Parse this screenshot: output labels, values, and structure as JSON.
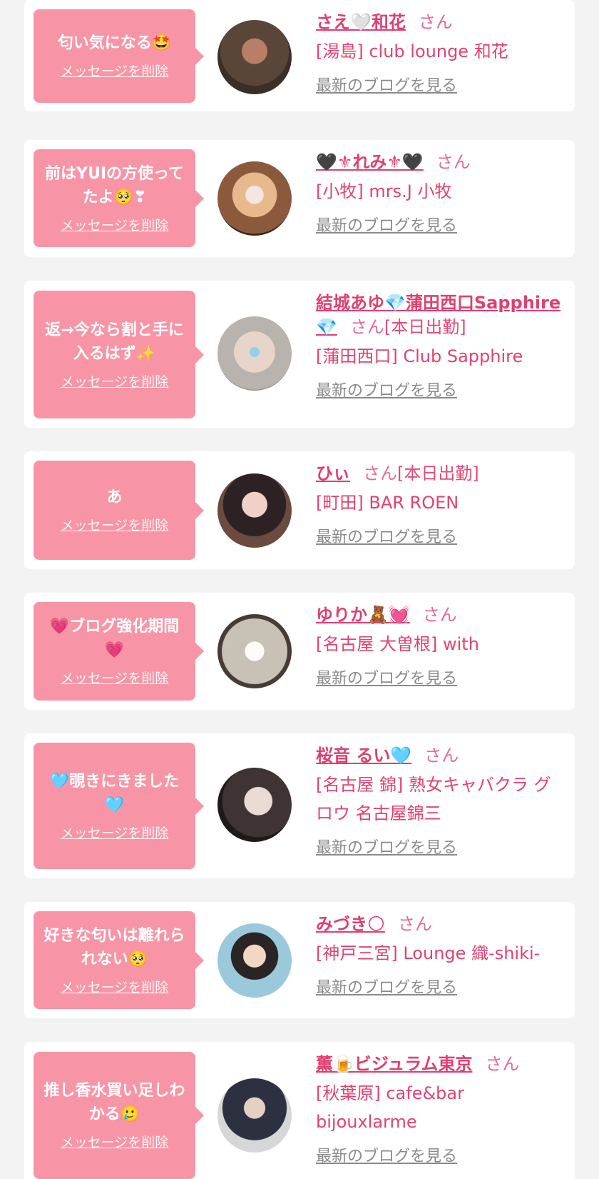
{
  "delete_label": "メッセージを削除",
  "blog_label": "最新のブログを見る",
  "san_label": "さん",
  "colors": {
    "bubble": "#f795a6",
    "name": "#e03f70",
    "shop": "#e4416f",
    "blog": "#8a8a8a",
    "background": "#f4f3f3"
  },
  "messages": [
    {
      "message": "匂い気になる🤩",
      "name": "さえ🤍和花",
      "status": "",
      "shop": "[湯島] club lounge 和花",
      "avatar_colors": [
        "#5a4638",
        "#b87f66",
        "#3b2e28"
      ]
    },
    {
      "message": "前はYUIの方使ってたよ🥺❣",
      "name": "🖤⚜れみ⚜🖤",
      "status": "",
      "shop": "[小牧] mrs.J 小牧",
      "avatar_colors": [
        "#8b5a3c",
        "#e9b98e",
        "#3a2418"
      ]
    },
    {
      "message": "返→今なら割と手に入るはず✨",
      "name": "結城あゆ💎蒲田西口Sapphire💎",
      "status": "[本日出勤]",
      "shop": "[蒲田西口] Club Sapphire",
      "avatar_colors": [
        "#b9b3ad",
        "#e8d5c9",
        "#8d847e"
      ]
    },
    {
      "message": "あ",
      "name": "ひぃ",
      "status": "[本日出勤]",
      "shop": "[町田] BAR ROEN",
      "avatar_colors": [
        "#2c2224",
        "#f0d1c7",
        "#6b4a3f"
      ]
    },
    {
      "message": "💗ブログ強化期間💗",
      "name": "ゆりか🧸💓",
      "status": "",
      "shop": "[名古屋 大曽根] with",
      "avatar_colors": [
        "#c8c1b6",
        "#fdfcfb",
        "#463b35"
      ]
    },
    {
      "message": "🩵覗きにきました🩵",
      "name": "桜音 るい🩵",
      "status": "",
      "shop": "[名古屋 錦] 熟女キャバクラ グロウ 名古屋錦三",
      "avatar_colors": [
        "#3f3433",
        "#eadbd5",
        "#1f1a1a"
      ]
    },
    {
      "message": "好きな匂いは離れられない🥺",
      "name": "みづき🌕",
      "status": "",
      "shop": "[神戸三宮] Lounge 織-shiki-",
      "avatar_colors": [
        "#9bc9dc",
        "#f3d7c5",
        "#2a2424"
      ]
    },
    {
      "message": "推し香水買い足しわかる🥲",
      "name": "薫🍺ビジュラム東京",
      "status": "",
      "shop": "[秋葉原] cafe&bar bijouxlarme",
      "avatar_colors": [
        "#d7d7d7",
        "#2d3040",
        "#e6cfc3"
      ]
    }
  ]
}
